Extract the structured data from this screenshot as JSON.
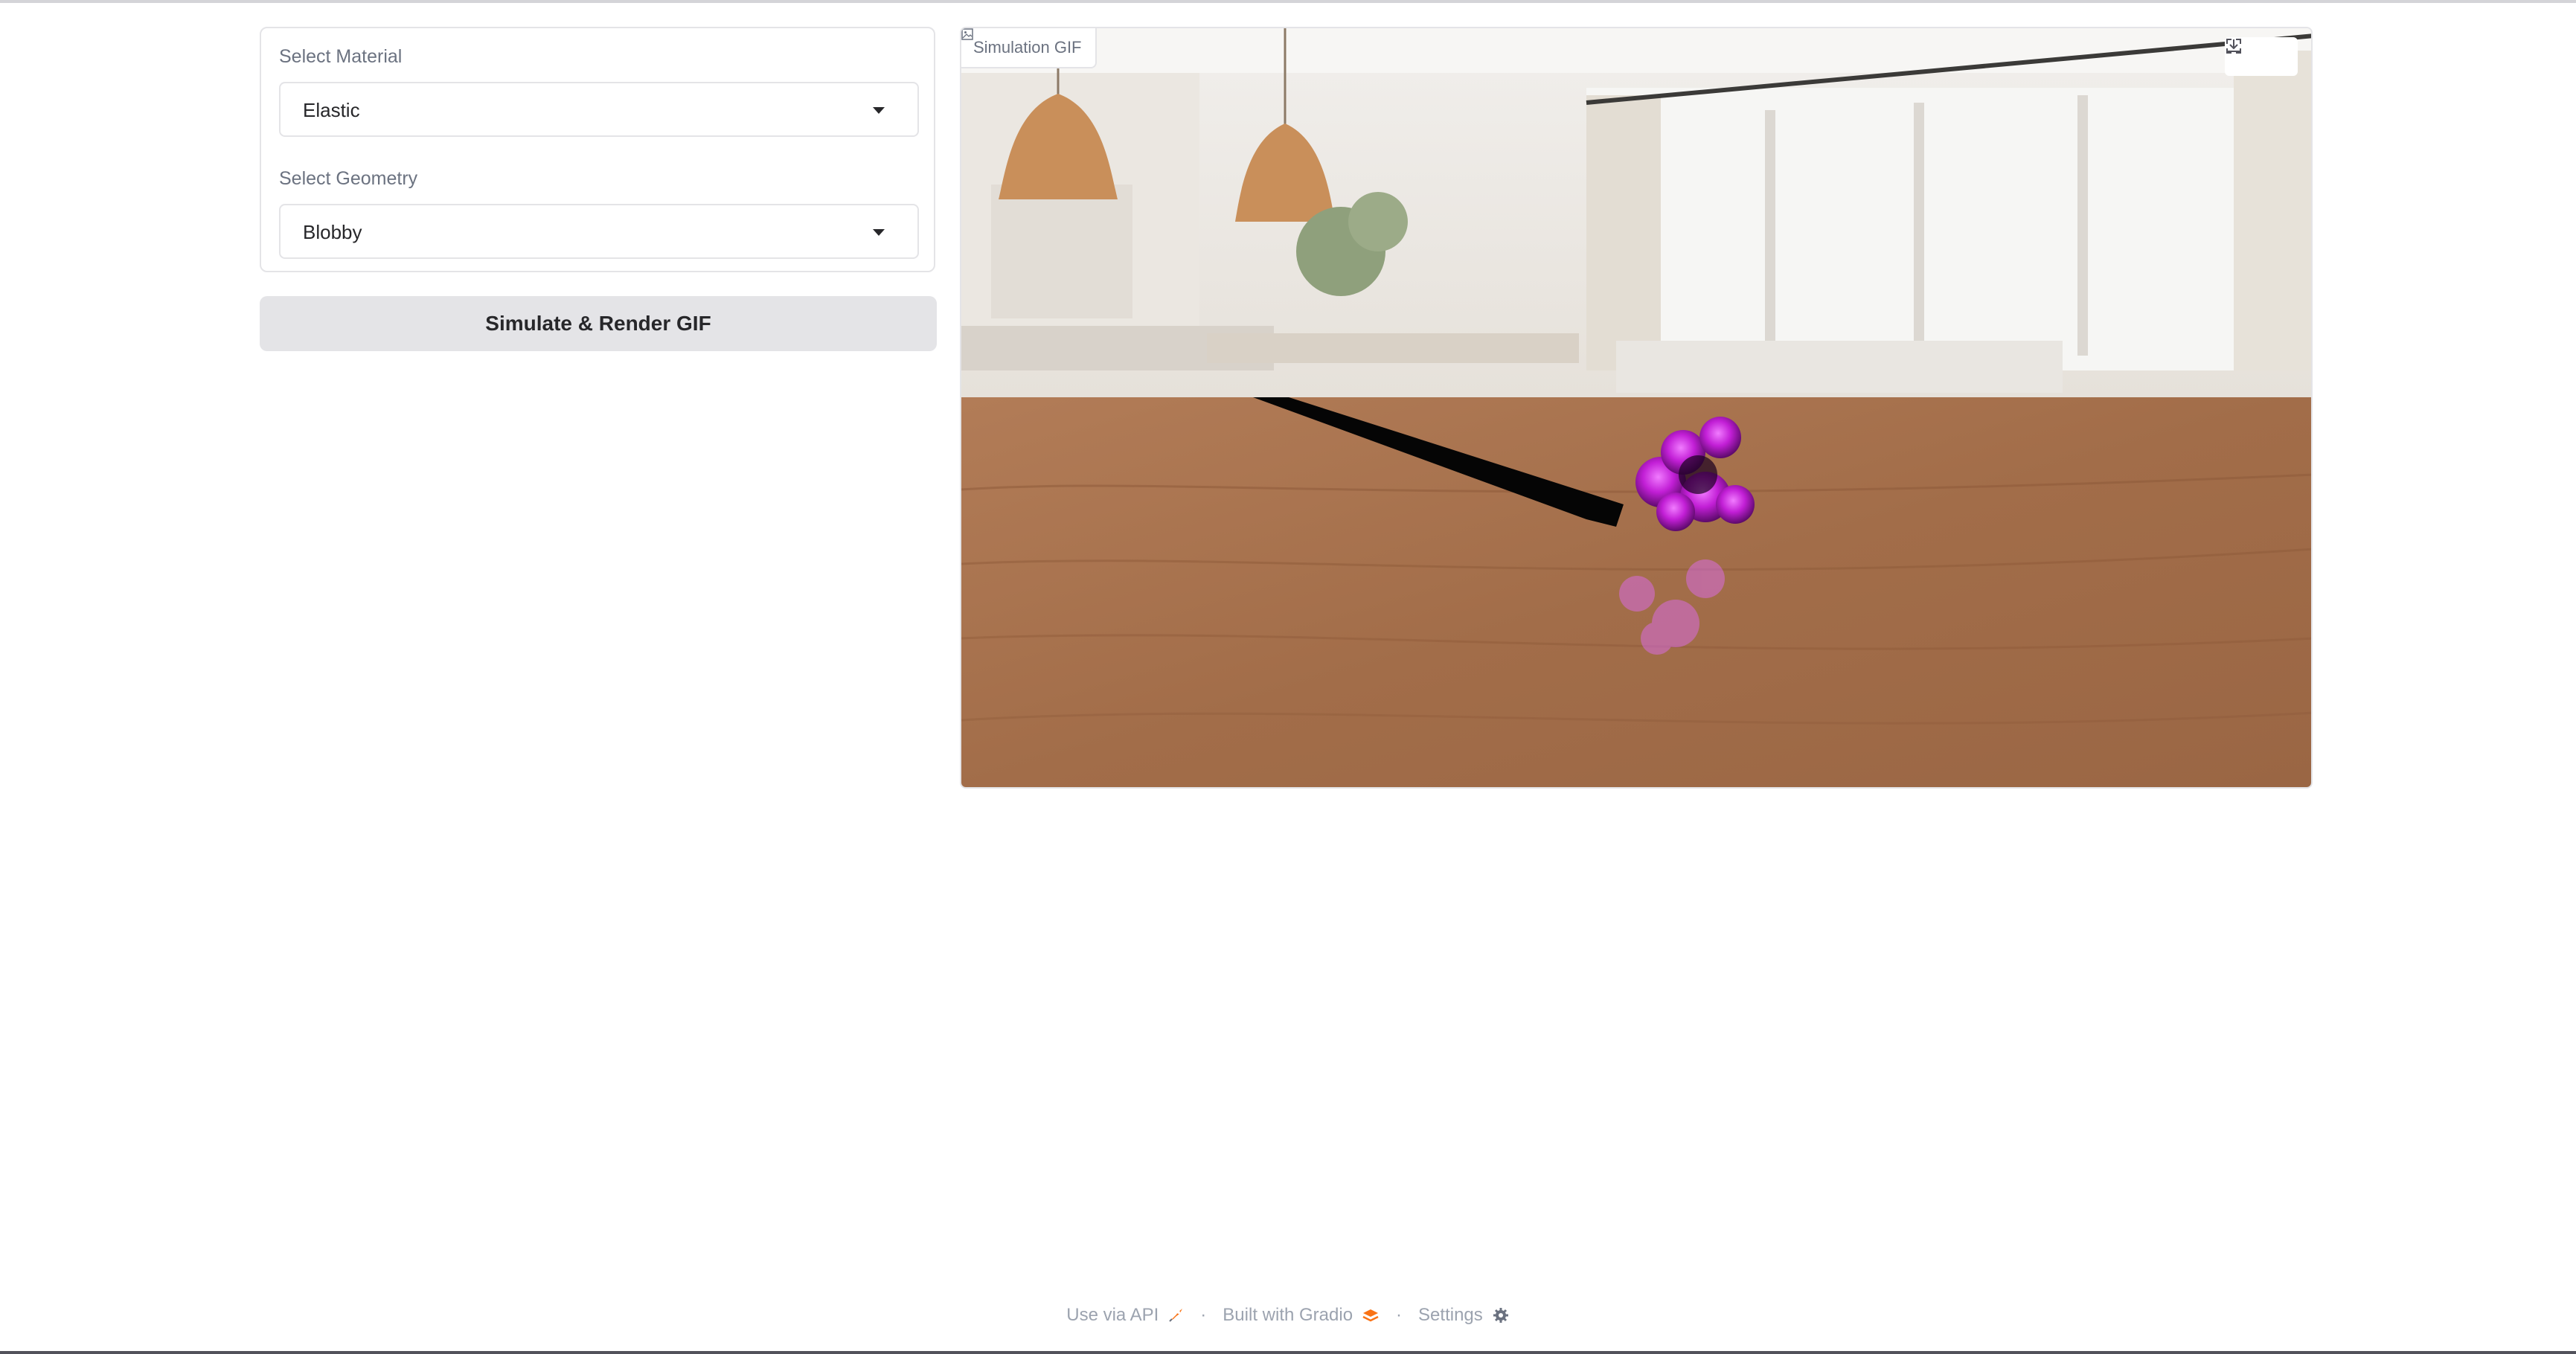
{
  "form": {
    "material": {
      "label": "Select Material",
      "value": "Elastic"
    },
    "geometry": {
      "label": "Select Geometry",
      "value": "Blobby"
    }
  },
  "actions": {
    "simulate_label": "Simulate & Render GIF"
  },
  "output": {
    "label": "Simulation GIF",
    "icons": [
      "image-icon",
      "fullscreen-icon",
      "download-icon"
    ]
  },
  "footer": {
    "api_label": "Use via API",
    "api_icon": "rocket-icon",
    "built_label": "Built with Gradio",
    "built_icon": "gradio-logo-icon",
    "settings_label": "Settings",
    "settings_icon": "gear-icon",
    "separator": "·"
  },
  "colors": {
    "object": "#c21fd6",
    "table_wood": "#a4704c",
    "button_bg": "#e4e4e7"
  }
}
